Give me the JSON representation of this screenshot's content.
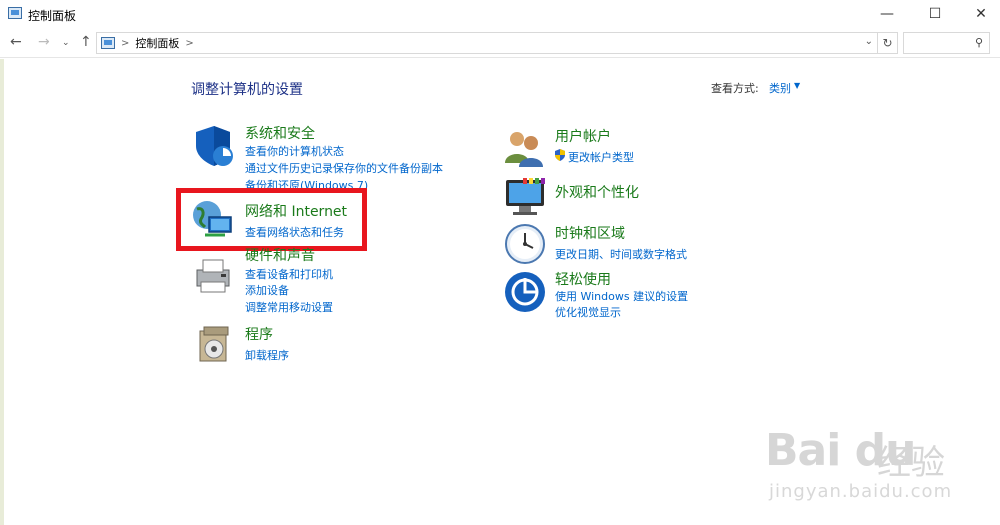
{
  "window": {
    "title": "控制面板",
    "minimize": "—",
    "maximize": "☐",
    "close": "✕"
  },
  "nav": {
    "back": "←",
    "forward": "→",
    "recent": "⌄",
    "up": "↑",
    "separator": ">",
    "path": "控制面板",
    "refresh": "↻",
    "search_placeholder": ""
  },
  "main": {
    "heading": "调整计算机的设置",
    "view_by_label": "查看方式:",
    "view_by_value": "类别"
  },
  "left_categories": [
    {
      "title": "系统和安全",
      "links": [
        "查看你的计算机状态",
        "通过文件历史记录保存你的文件备份副本",
        "备份和还原(Windows 7)"
      ]
    },
    {
      "title": "网络和 Internet",
      "links": [
        "查看网络状态和任务"
      ]
    },
    {
      "title": "硬件和声音",
      "links": [
        "查看设备和打印机",
        "添加设备",
        "调整常用移动设置"
      ]
    },
    {
      "title": "程序",
      "links": [
        "卸载程序"
      ]
    }
  ],
  "right_categories": [
    {
      "title": "用户帐户",
      "links": [
        "更改帐户类型"
      ]
    },
    {
      "title": "外观和个性化",
      "links": []
    },
    {
      "title": "时钟和区域",
      "links": [
        "更改日期、时间或数字格式"
      ]
    },
    {
      "title": "轻松使用",
      "links": [
        "使用 Windows 建议的设置",
        "优化视觉显示"
      ]
    }
  ],
  "watermark": {
    "logo": "Bai du",
    "text": "经验",
    "url": "jingyan.baidu.com"
  },
  "colors": {
    "category_title": "#1a7a1a",
    "link": "#0066cc",
    "heading": "#1e3287",
    "highlight": "#e8161e"
  }
}
